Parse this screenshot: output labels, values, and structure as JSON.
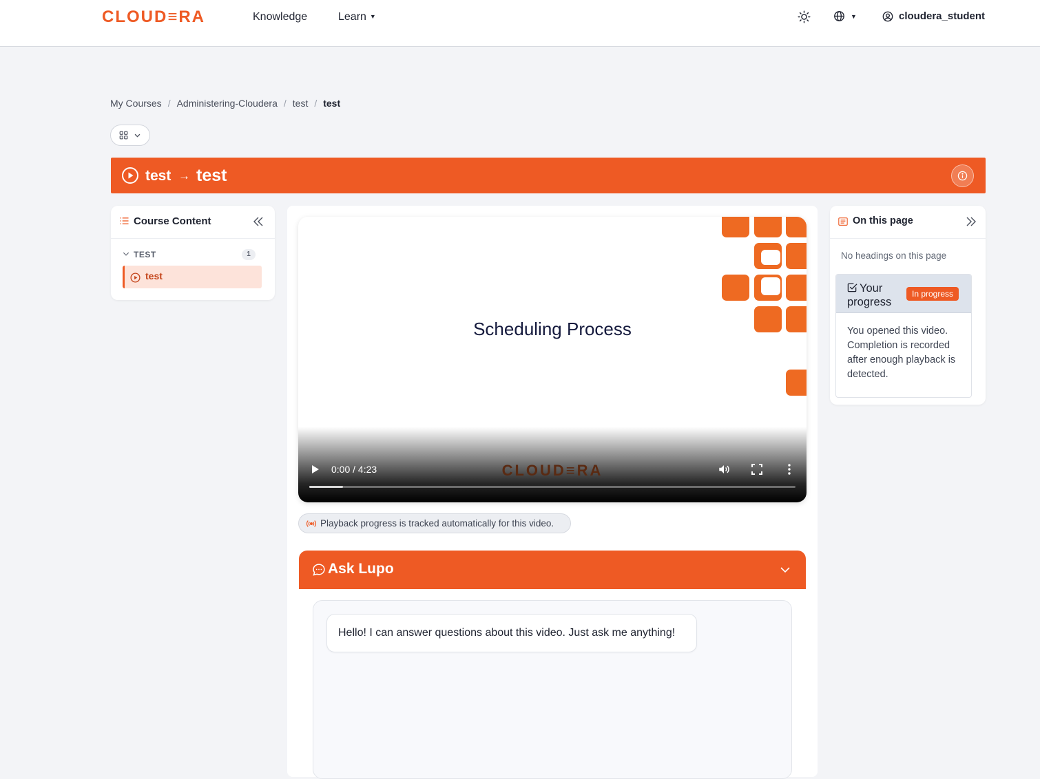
{
  "nav": {
    "logo": "CLOUD≡RA",
    "knowledge": "Knowledge",
    "learn": "Learn",
    "username": "cloudera_student"
  },
  "breadcrumb": {
    "items": [
      "My Courses",
      "Administering-Cloudera",
      "test"
    ],
    "current": "test",
    "separator": "/"
  },
  "banner": {
    "module": "test",
    "arrow": "→",
    "lesson": "test"
  },
  "course_content": {
    "title": "Course Content",
    "section_title": "TEST",
    "section_count": "1",
    "items": [
      {
        "label": "test"
      }
    ]
  },
  "video": {
    "slide_title": "Scheduling Process",
    "watermark": "CLOUD≡RA",
    "time": "0:00 / 4:23",
    "buffered_fraction": 0.07
  },
  "tracking": {
    "text": "Playback progress is tracked automatically for this video."
  },
  "ask_lupo": {
    "title": "Ask Lupo",
    "greeting": "Hello! I can answer questions about this video. Just ask me anything!"
  },
  "on_this_page": {
    "title": "On this page",
    "empty": "No headings on this page",
    "progress_title": "Your progress",
    "progress_badge": "In progress",
    "progress_text": "You opened this video. Completion is recorded after enough playback is detected."
  },
  "colors": {
    "brand": "#ee5a24",
    "page_bg": "#f3f4f7"
  }
}
